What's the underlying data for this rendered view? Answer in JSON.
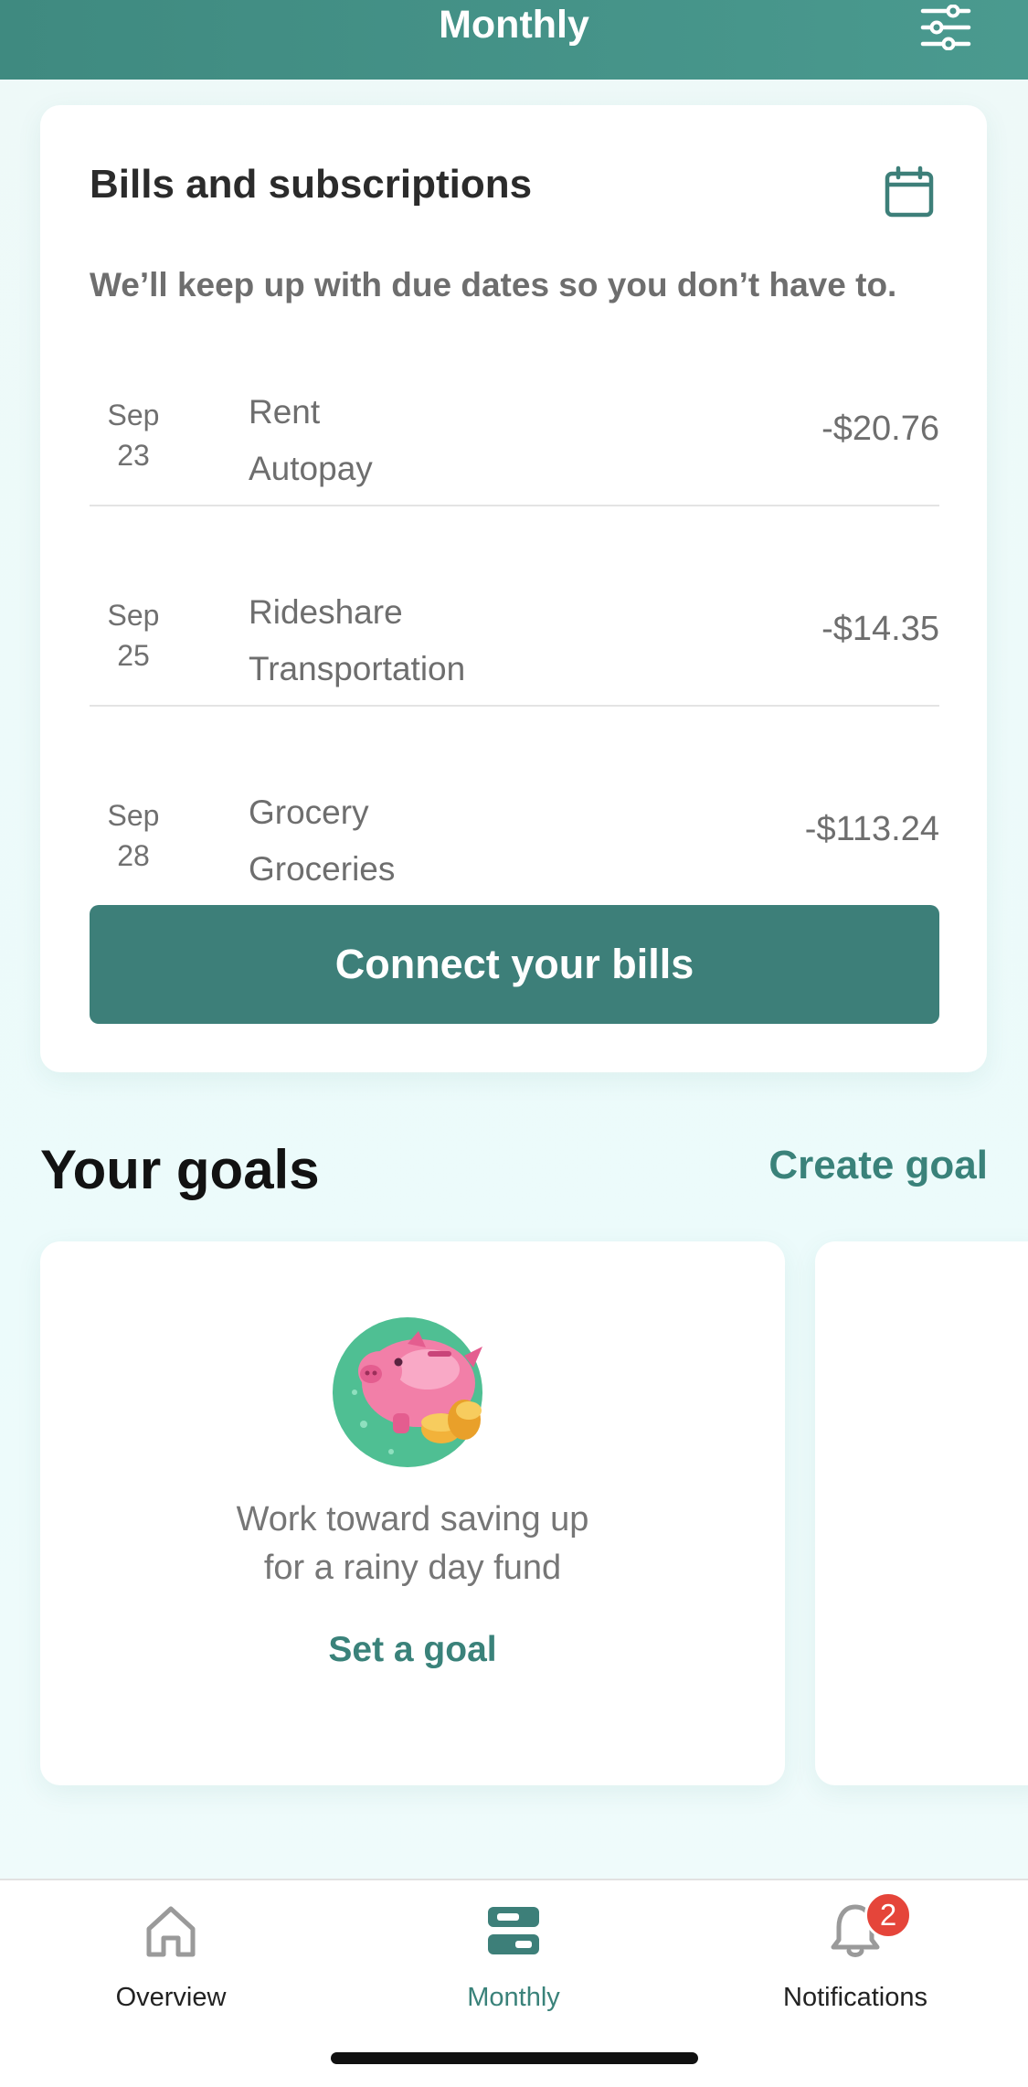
{
  "header": {
    "title": "Monthly",
    "filter_icon": "sliders-icon"
  },
  "bills": {
    "title": "Bills and subscriptions",
    "calendar_icon": "calendar-icon",
    "subtitle": "We’ll keep up with due dates so you don’t have to.",
    "items": [
      {
        "month": "Sep",
        "day": "23",
        "name": "Rent",
        "category": "Autopay",
        "amount": "-$20.76"
      },
      {
        "month": "Sep",
        "day": "25",
        "name": "Rideshare",
        "category": "Transportation",
        "amount": "-$14.35"
      },
      {
        "month": "Sep",
        "day": "28",
        "name": "Grocery",
        "category": "Groceries",
        "amount": "-$113.24"
      }
    ],
    "connect_label": "Connect your bills"
  },
  "goals": {
    "title": "Your goals",
    "create_label": "Create goal",
    "card": {
      "illustration": "piggy-bank-icon",
      "description_line1": "Work toward saving up",
      "description_line2": "for a rainy day fund",
      "action_label": "Set a goal"
    }
  },
  "tabbar": {
    "tabs": [
      {
        "label": "Overview",
        "icon": "home-icon",
        "active": false
      },
      {
        "label": "Monthly",
        "icon": "monthly-icon",
        "active": true
      },
      {
        "label": "Notifications",
        "icon": "bell-icon",
        "active": false,
        "badge": "2"
      }
    ]
  },
  "colors": {
    "accent": "#3d7f79",
    "header": "#46938a",
    "badge": "#e5453a",
    "active_tab": "#3a827a",
    "inactive_tab": "#9a9a9a"
  }
}
